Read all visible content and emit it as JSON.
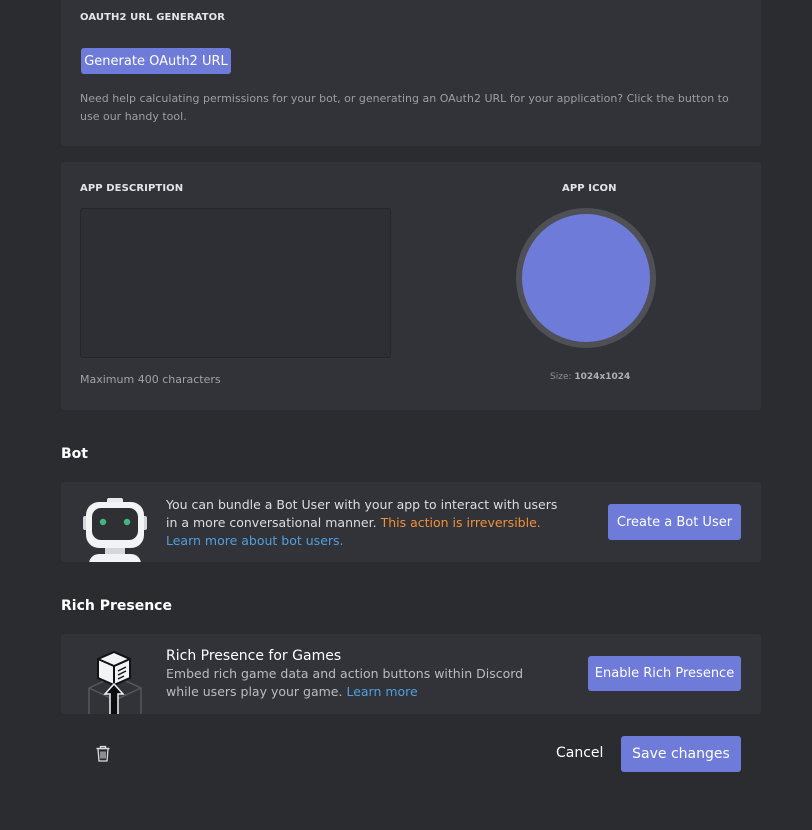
{
  "oauth": {
    "heading": "OAUTH2 URL GENERATOR",
    "button_label": "Generate OAuth2 URL",
    "help_text": "Need help calculating permissions for your bot, or generating an OAuth2 URL for your application? Click the button to use our handy tool."
  },
  "description": {
    "heading": "APP DESCRIPTION",
    "value": "",
    "hint": "Maximum 400 characters"
  },
  "app_icon": {
    "heading": "APP ICON",
    "size_label": "Size:",
    "size_value": "1024x1024",
    "color": "#6f7bd8"
  },
  "bot": {
    "section_title": "Bot",
    "text": "You can bundle a Bot User with your app to interact with users in a more conversational manner.",
    "warning": "This action is irreversible.",
    "learn_more": "Learn more about bot users.",
    "button_label": "Create a Bot User"
  },
  "rich_presence": {
    "section_title": "Rich Presence",
    "title": "Rich Presence for Games",
    "description": "Embed rich game data and action buttons within Discord while users play your game.",
    "learn_more": "Learn more",
    "button_label": "Enable Rich Presence"
  },
  "footer": {
    "cancel_label": "Cancel",
    "save_label": "Save changes"
  },
  "colors": {
    "accent": "#6f7bd8",
    "warning": "#f0903a",
    "link": "#4f9fde",
    "card": "#323338",
    "background": "#2b2c30"
  }
}
